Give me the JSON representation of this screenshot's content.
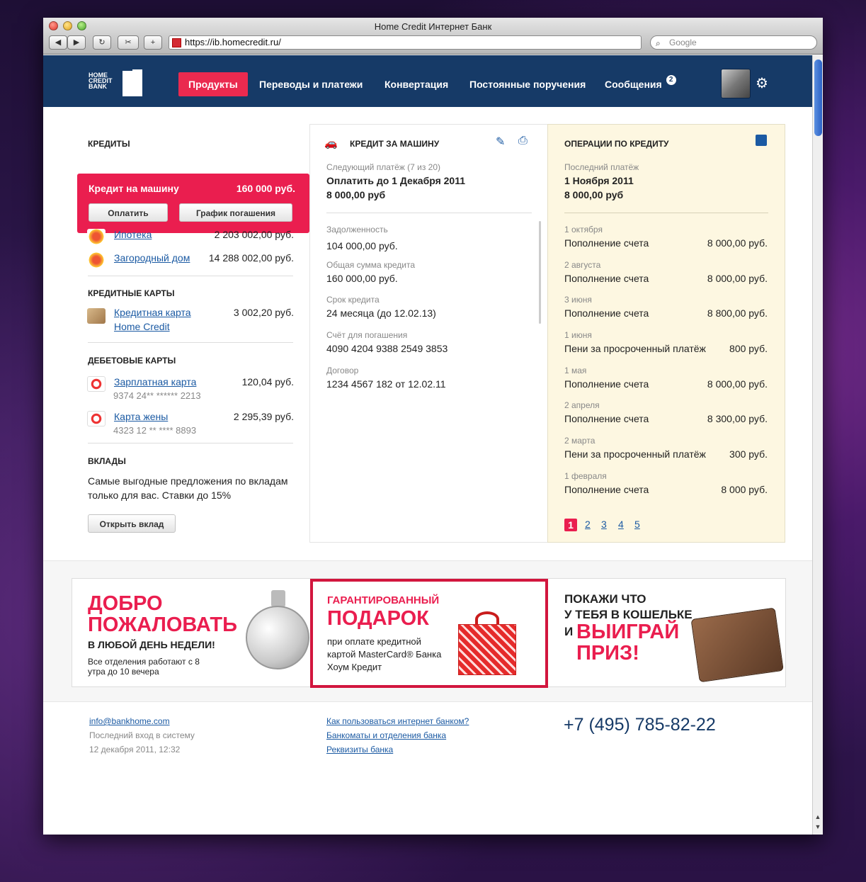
{
  "browser": {
    "title": "Home Credit Интернет Банк",
    "url": "https://ib.homecredit.ru/",
    "search_placeholder": "Google"
  },
  "logo": {
    "text": "HOME CREDIT BANK"
  },
  "nav": {
    "items": [
      "Продукты",
      "Переводы и платежи",
      "Конвертация",
      "Постоянные поручения",
      "Сообщения"
    ],
    "messages_badge": "2"
  },
  "left": {
    "credits_title": "КРЕДИТЫ",
    "selected": {
      "name": "Кредит на машину",
      "amount": "160 000 руб.",
      "pay_btn": "Оплатить",
      "schedule_btn": "График погашения"
    },
    "credits": [
      {
        "name": "Ипотека",
        "amount": "2 203 002,00 руб."
      },
      {
        "name": "Загородный дом",
        "amount": "14 288 002,00 руб."
      }
    ],
    "cc_title": "КРЕДИТНЫЕ КАРТЫ",
    "cc": {
      "name1": "Кредитная карта",
      "name2": "Home Credit",
      "amount": "3 002,20 руб."
    },
    "debit_title": "ДЕБЕТОВЫЕ КАРТЫ",
    "debit": [
      {
        "name": "Зарплатная карта",
        "amount": "120,04 руб.",
        "number": "9374 24** ****** 2213"
      },
      {
        "name": "Карта жены",
        "amount": "2 295,39 руб.",
        "number": "4323 12 ** **** 8893"
      }
    ],
    "deposits_title": "ВКЛАДЫ",
    "deposits_text1": "Самые выгодные предложения по вкладам",
    "deposits_text2": "только для вас. Ставки до 15%",
    "open_btn": "Открыть вклад"
  },
  "middle": {
    "title": "КРЕДИТ ЗА МАШИНУ",
    "next_label": "Следующий платёж (7 из 20)",
    "next_value": "Оплатить до 1 Декабря 2011",
    "next_amount": "8 000,00 руб",
    "fields": [
      {
        "label": "Задолженность",
        "value": "104 000,00 руб."
      },
      {
        "label": "Общая сумма кредита",
        "value": "160 000,00 руб."
      },
      {
        "label": "Срок кредита",
        "value": "24 месяца (до 12.02.13)"
      },
      {
        "label": "Счёт для погашения",
        "value": "4090 4204 9388 2549 3853"
      },
      {
        "label": "Договор",
        "value": "1234 4567 182 от 12.02.11"
      }
    ]
  },
  "ops": {
    "title": "ОПЕРАЦИИ ПО КРЕДИТУ",
    "last_label": "Последний платёж",
    "last_date": "1 Ноября 2011",
    "last_amount": "8 000,00 руб",
    "items": [
      {
        "date": "1 октября",
        "name": "Пополнение счета",
        "amount": "8 000,00 руб."
      },
      {
        "date": "2 августа",
        "name": "Пополнение счета",
        "amount": "8 000,00 руб."
      },
      {
        "date": "3 июня",
        "name": "Пополнение счета",
        "amount": "8 800,00 руб."
      },
      {
        "date": "1 июня",
        "name": "Пени за просроченный платёж",
        "amount": "800 руб."
      },
      {
        "date": "1 мая",
        "name": "Пополнение счета",
        "amount": "8 000,00 руб."
      },
      {
        "date": "2 апреля",
        "name": "Пополнение счета",
        "amount": "8 300,00 руб."
      },
      {
        "date": "2 марта",
        "name": "Пени за просроченный платёж",
        "amount": "300 руб."
      },
      {
        "date": "1 февраля",
        "name": "Пополнение счета",
        "amount": "8 000 руб."
      }
    ],
    "pages": [
      "1",
      "2",
      "3",
      "4",
      "5"
    ]
  },
  "banners": {
    "b1": {
      "line1": "ДОБРО",
      "line2": "ПОЖАЛОВАТЬ",
      "sub": "В ЛЮБОЙ ДЕНЬ НЕДЕЛИ!",
      "note": "Все отделения работают с 8 утра до 10 вечера"
    },
    "b2": {
      "line1": "ГАРАНТИРОВАННЫЙ",
      "line2": "ПОДАРОК",
      "text": "при оплате кредитной картой MasterCard® Банка Хоум Кредит"
    },
    "b3": {
      "line1": "ПОКАЖИ ЧТО",
      "line2": "У ТЕБЯ В КОШЕЛЬКЕ",
      "and": "И",
      "win1": "ВЫИГРАЙ",
      "win2": "ПРИЗ!"
    }
  },
  "footer": {
    "email": "info@bankhome.com",
    "last_login_label": "Последний вход в систему",
    "last_login": "12 декабря 2011, 12:32",
    "links": [
      "Как пользоваться интернет банком?",
      "Банкоматы и отделения банка",
      "Реквизиты банка"
    ],
    "phone": "+7 (495) 785-82-22"
  },
  "colors": {
    "nav_bg": "#163a67",
    "accent": "#ea1e4f",
    "link": "#1b5aa3",
    "ops_bg": "#fdf7e1"
  }
}
